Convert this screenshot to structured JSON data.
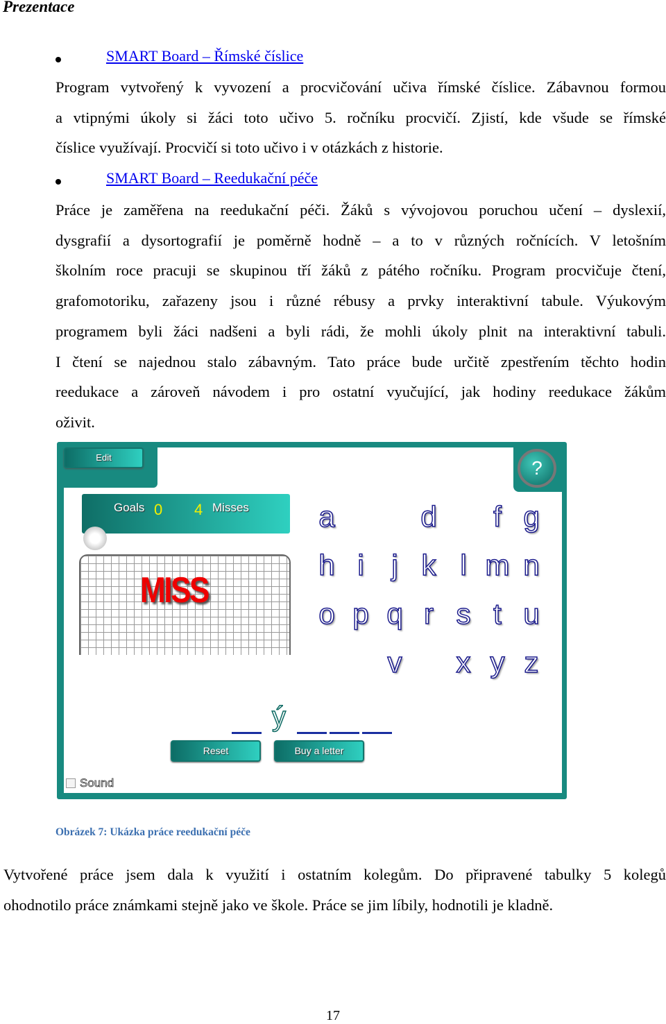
{
  "heading": "Prezentace",
  "links": [
    "SMART Board – Římské číslice",
    "SMART Board – Reedukační péče"
  ],
  "para1": [
    "Program vytvořený k vyvození a procvičování učiva římské číslice. Zábavnou formou",
    "a vtipnými úkoly si žáci toto učivo 5. ročníku procvičí. Zjistí, kde všude se římské",
    "číslice využívají. Procvičí si toto učivo i v otázkách z historie."
  ],
  "para2": [
    "Práce je zaměřena na reedukační péči. Žáků s vývojovou poruchou učení – dyslexií,",
    "dysgrafií a dysortografií je poměrně hodně – a to v různých ročnících. V letošním",
    "školním roce pracuji se skupinou tří žáků z pátého ročníku. Program procvičuje čtení,",
    "grafomotoriku, zařazeny jsou i různé rébusy a prvky interaktivní tabule. Výukovým",
    "programem byli žáci nadšeni a byli rádi, že mohli úkoly plnit na interaktivní tabuli.",
    "I čtení se najednou stalo zábavným. Tato práce bude určitě zpestřením těchto hodin",
    "reedukace a zároveň návodem i pro ostatní vyučující, jak hodiny reedukace žákům",
    "oživit."
  ],
  "game": {
    "edit": "Edit",
    "help": "?",
    "goals_label": "Goals",
    "goals": "0",
    "misses": "4",
    "misses_label": "Misses",
    "miss": "MISS",
    "letters": [
      [
        "a",
        "",
        "",
        "d",
        "",
        "f",
        "g"
      ],
      [
        "h",
        "i",
        "j",
        "k",
        "l",
        "m",
        "n"
      ],
      [
        "o",
        "p",
        "q",
        "r",
        "s",
        "t",
        "u"
      ],
      [
        "",
        "",
        "v",
        "",
        "x",
        "y",
        "z"
      ]
    ],
    "revealed": "ý",
    "reset": "Reset",
    "buy": "Buy a letter",
    "sound": "Sound",
    "colors": {
      "frame": "#188a80",
      "miss": "#e00000",
      "score_numbers": "#f4f000"
    }
  },
  "caption": "Obrázek 7: Ukázka práce reedukační péče",
  "para3": [
    "Vytvořené práce jsem dala k využití i ostatním kolegům. Do připravené tabulky 5 kolegů",
    "ohodnotilo práce známkami stejně jako ve škole. Práce se jim líbily, hodnotili je kladně."
  ],
  "page_number": "17"
}
